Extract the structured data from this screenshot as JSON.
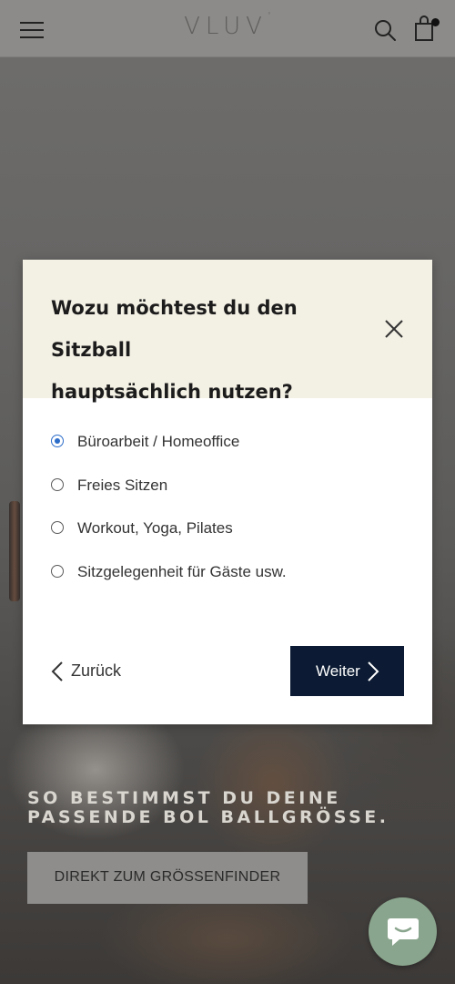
{
  "header": {
    "logo_text": "VLUV",
    "logo_mark": "°",
    "icons": [
      "menu-icon",
      "search-icon",
      "shopping-bag-icon"
    ]
  },
  "modal": {
    "title_line1": "Wozu möchtest du den Sitzball",
    "title_line2": "hauptsächlich nutzen?",
    "options": [
      {
        "label": "Büroarbeit / Homeoffice",
        "selected": true
      },
      {
        "label": "Freies Sitzen",
        "selected": false
      },
      {
        "label": "Workout, Yoga, Pilates",
        "selected": false
      },
      {
        "label": "Sitzgelegenheit für Gäste usw.",
        "selected": false
      }
    ],
    "back_label": "Zurück",
    "next_label": "Weiter"
  },
  "hero": {
    "heading_line1": "SO BESTIMMST DU DEINE",
    "heading_line2": "PASSENDE BOL BALLGRÖSSE.",
    "cta_label": "DIREKT ZUM GRÖSSENFINDER"
  },
  "chat": {
    "icon": "chat-bubble-icon"
  },
  "colors": {
    "header_bg": "#8c8b89",
    "modal_head_bg": "#f3f0e4",
    "primary_button": "#0c1b33",
    "radio_accent": "#2c6cc9",
    "chat_button": "#8aa58d"
  }
}
